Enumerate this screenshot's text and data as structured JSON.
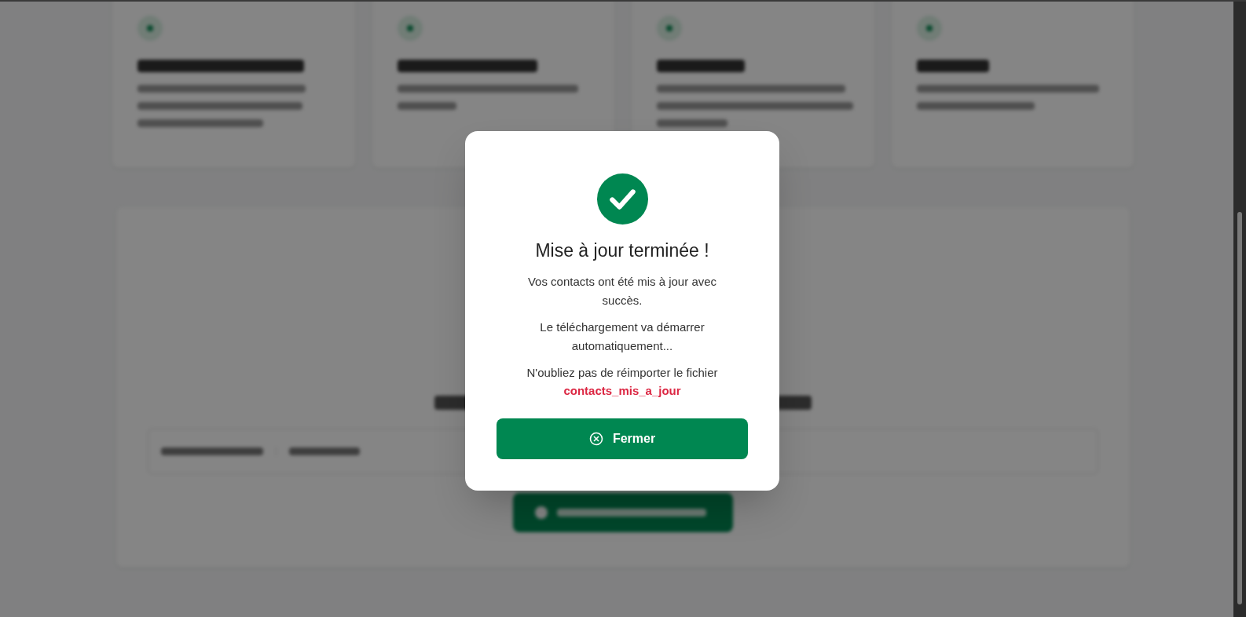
{
  "modal": {
    "title": "Mise à jour terminée !",
    "messages": [
      "Vos contacts ont été mis à jour avec succès.",
      "Le téléchargement va démarrer automatiquement..."
    ],
    "reminder": "N'oubliez pas de réimporter le fichier",
    "file_name": "contacts_mis_a_jour",
    "close_button": "Fermer"
  }
}
